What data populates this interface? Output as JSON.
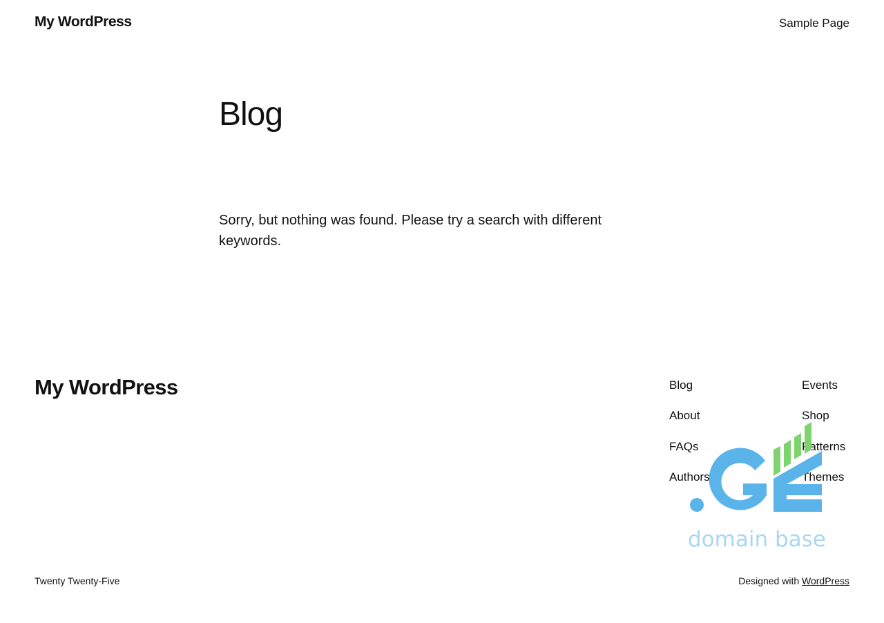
{
  "header": {
    "site_title": "My WordPress",
    "nav": [
      "Sample Page"
    ]
  },
  "main": {
    "heading": "Blog",
    "message": "Sorry, but nothing was found. Please try a search with different keywords."
  },
  "footer": {
    "site_title": "My WordPress",
    "nav_left": [
      "Blog",
      "About",
      "FAQs",
      "Authors"
    ],
    "nav_right": [
      "Events",
      "Shop",
      "Patterns",
      "Themes"
    ],
    "theme_name": "Twenty Twenty-Five",
    "credit_prefix": "Designed with",
    "credit_link": "WordPress"
  },
  "watermark": {
    "logo_text": ".GE",
    "tagline": "domain base",
    "colors": {
      "blue": "#5ab4ea",
      "green": "#7fd36e",
      "light_blue": "#a9d6f2"
    }
  }
}
